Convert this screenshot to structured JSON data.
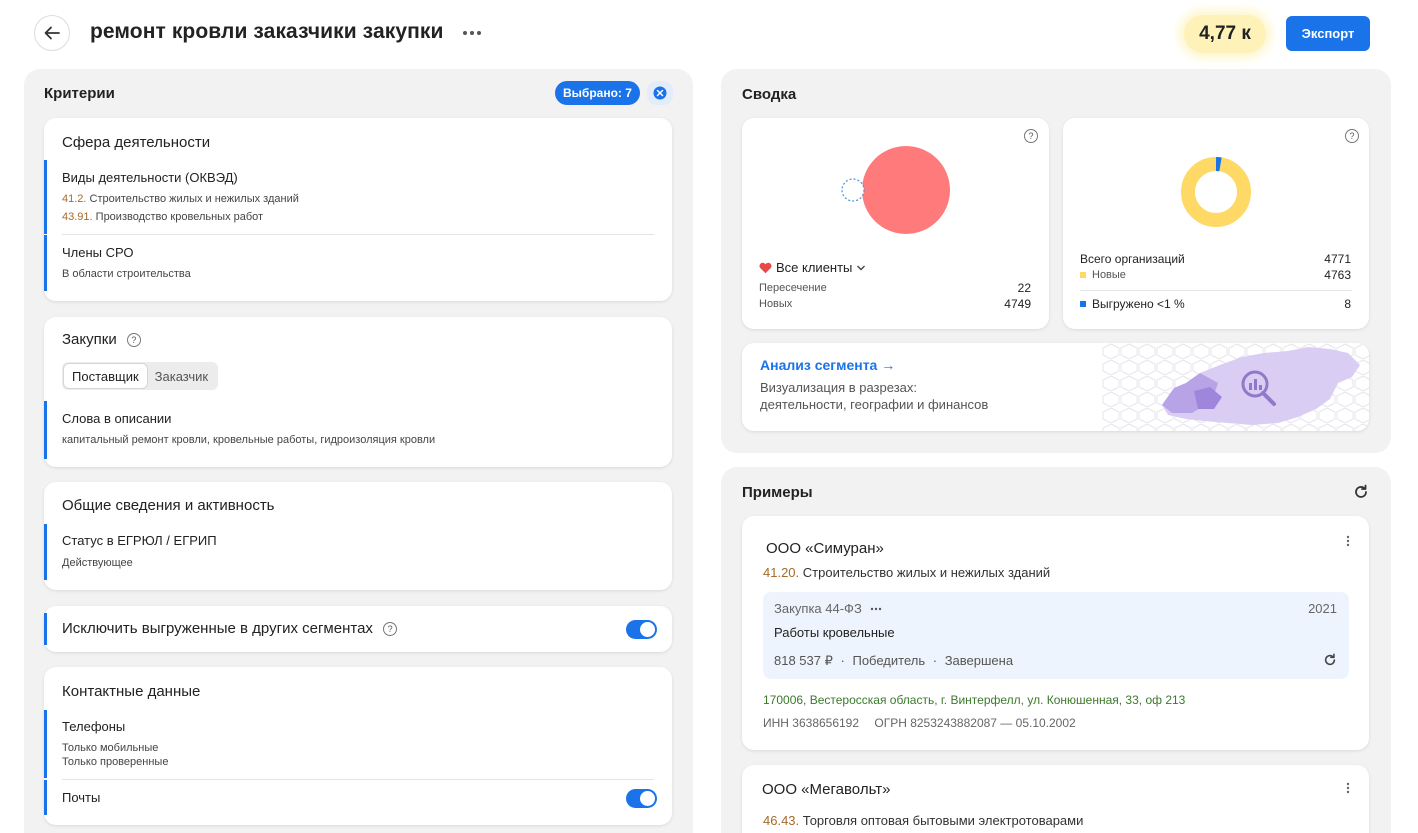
{
  "header": {
    "title": "ремонт кровли заказчики закупки",
    "count": "4,77 к",
    "export_label": "Экспорт"
  },
  "criteria": {
    "title": "Критерии",
    "selected_label": "Выбрано: 7",
    "activity": {
      "title": "Сфера деятельности",
      "okved_title": "Виды деятельности (ОКВЭД)",
      "okved_items": [
        {
          "code": "41.2.",
          "text": "Строительство жилых и нежилых зданий"
        },
        {
          "code": "43.91.",
          "text": "Производство кровельных работ"
        }
      ],
      "sro_title": "Члены СРО",
      "sro_value": "В области строительства"
    },
    "purchases": {
      "title": "Закупки",
      "tabs": [
        "Поставщик",
        "Заказчик"
      ],
      "words_title": "Слова в описании",
      "words_value": "капитальный ремонт кровли, кровельные работы, гидроизоляция кровли"
    },
    "general": {
      "title": "Общие сведения и активность",
      "status_title": "Статус в ЕГРЮЛ / ЕГРИП",
      "status_value": "Действующее"
    },
    "exclude": {
      "label": "Исключить выгруженные в других сегментах",
      "enabled": true
    },
    "contacts": {
      "title": "Контактные данные",
      "phones_title": "Телефоны",
      "phones_values": [
        "Только мобильные",
        "Только проверенные"
      ],
      "emails_title": "Почты",
      "emails_enabled": true
    }
  },
  "summary": {
    "title": "Сводка",
    "clients": {
      "selector": "Все клиенты",
      "intersection_label": "Пересечение",
      "intersection_value": "22",
      "new_label": "Новых",
      "new_value": "4749",
      "colors": {
        "main": "#ff7b7b",
        "dotted": "#4a90e2"
      }
    },
    "orgs": {
      "total_label": "Всего организаций",
      "total_value": "4771",
      "new_label": "Новые",
      "new_value": "4763",
      "exported_label": "Выгружено <1 %",
      "exported_value": "8",
      "colors": {
        "new": "#ffd966",
        "exported": "#1a73e8"
      }
    },
    "analysis": {
      "link": "Анализ сегмента →",
      "description_line1": "Визуализация в разрезах:",
      "description_line2": "деятельности, географии и финансов"
    }
  },
  "examples": {
    "title": "Примеры",
    "items": [
      {
        "name": "ООО «Симуран»",
        "okved_code": "41.20.",
        "okved_text": "Строительство жилых и нежилых зданий",
        "procurement": {
          "type": "Закупка 44-ФЗ",
          "year": "2021",
          "subject": "Работы кровельные",
          "amount": "818 537 ₽",
          "role": "Победитель",
          "status": "Завершена"
        },
        "address": "170006, Вестеросская область, г. Винтерфелл, ул. Конюшенная, 33, оф 213",
        "inn": "ИНН 3638656192",
        "ogrn": "ОГРН 8253243882087 — 05.10.2002"
      },
      {
        "name": "ООО «Мегавольт»",
        "okved_code": "46.43.",
        "okved_text": "Торговля оптовая бытовыми электротоварами"
      }
    ]
  }
}
